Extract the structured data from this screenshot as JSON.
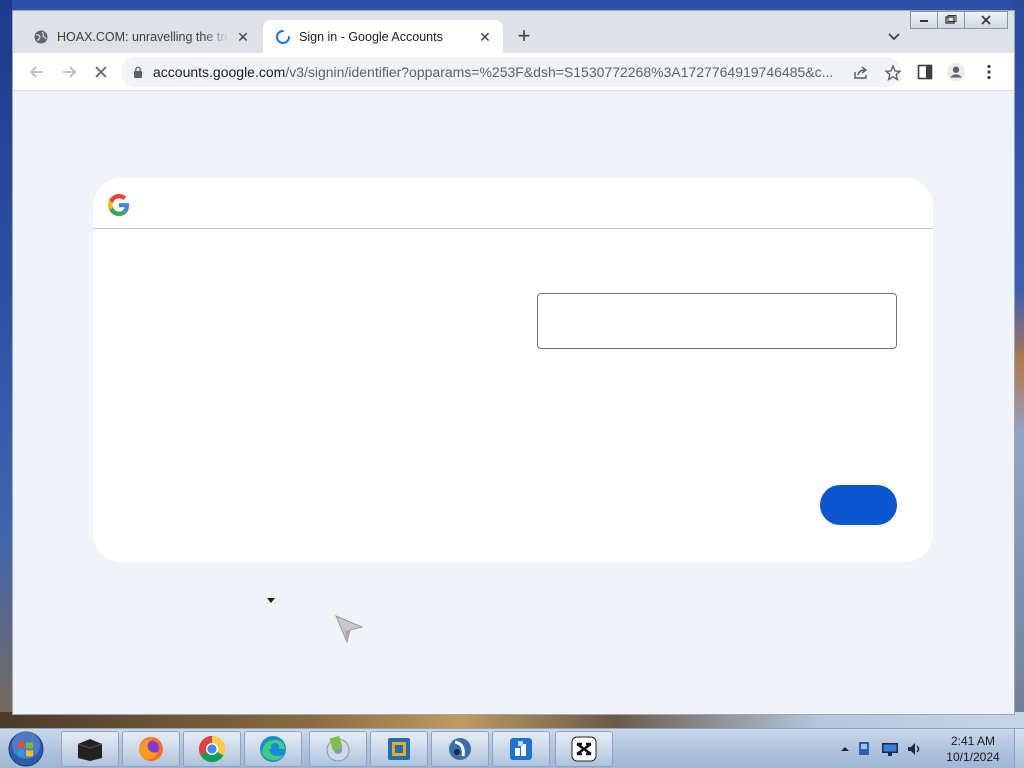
{
  "browser": {
    "tabs": [
      {
        "title": "HOAX.COM: unravelling the truth",
        "icon": "globe-icon",
        "active": false
      },
      {
        "title": "Sign in - Google Accounts",
        "icon": "loading-spinner-icon",
        "active": true
      }
    ],
    "new_tab_symbol": "+",
    "url_host": "accounts.google.com",
    "url_path": "/v3/signin/identifier?opparams=%253F&dsh=S1530772268%3A1727764919746485&c..."
  },
  "page": {
    "logo": "google-g-logo",
    "accent_color": "#0b57d0",
    "background_color": "#f0f4f9"
  },
  "taskbar": {
    "apps": [
      "blackbox-icon",
      "firefox-icon",
      "chrome-icon",
      "edge-icon",
      "media-icon",
      "virtualbox-icon",
      "app-icon",
      "installer-icon",
      "capcut-icon"
    ],
    "time": "2:41 AM",
    "date": "10/1/2024"
  }
}
